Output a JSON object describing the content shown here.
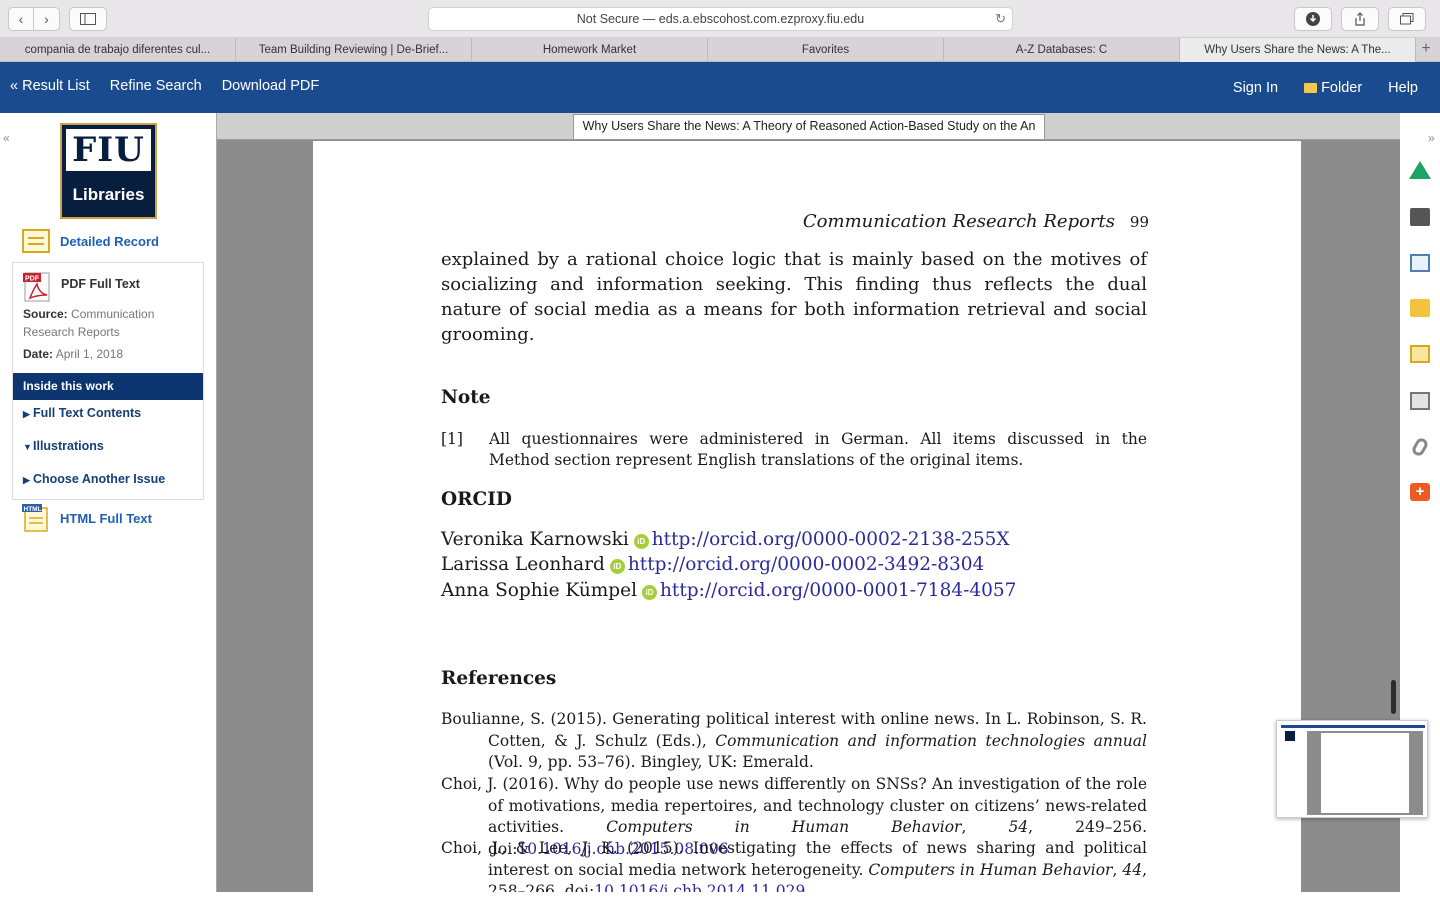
{
  "browser": {
    "url": "Not Secure — eds.a.ebscohost.com.ezproxy.fiu.edu",
    "tabs": [
      {
        "label": "compania de trabajo diferentes cul..."
      },
      {
        "label": "Team Building Reviewing | De-Brief..."
      },
      {
        "label": "Homework Market"
      },
      {
        "label": "Favorites"
      },
      {
        "label": "A-Z Databases: C"
      },
      {
        "label": "Why Users Share the News: A The..."
      }
    ],
    "new_tab": "+",
    "back": "‹",
    "forward": "›",
    "reload": "↻"
  },
  "topnav": {
    "result_list": "« Result List",
    "refine_search": "Refine Search",
    "download_pdf": "Download PDF",
    "sign_in": "Sign In",
    "folder": "Folder",
    "help": "Help"
  },
  "sidebar": {
    "collapse": "«",
    "logo_top": "FIU",
    "logo_bottom": "Libraries",
    "detailed_record": "Detailed Record",
    "pdf_full_text": "PDF Full Text",
    "pdf_badge": "PDF",
    "source_label": "Source:",
    "source_value": "Communication Research Reports",
    "date_label": "Date:",
    "date_value": "April 1, 2018",
    "inside_this_work": "Inside this work",
    "full_text_contents": "Full Text Contents",
    "illustrations": "Illustrations",
    "choose_another_issue": "Choose Another Issue",
    "html_full_text": "HTML Full Text",
    "html_badge": "HTML"
  },
  "viewer": {
    "doc_title": "Why Users Share the News: A Theory of Reasoned Action-Based Study on the An",
    "running_head": "Communication Research Reports",
    "page_number": "99",
    "intro_paragraph": "explained by a rational choice logic that is mainly based on the motives of socializing and information seeking. This finding thus reflects the dual nature of social media as a means for both information retrieval and social grooming.",
    "note_heading": "Note",
    "note_number": "[1]",
    "note_text": "All questionnaires were administered in German. All items discussed in the Method section represent English translations of the original items.",
    "orcid_heading": "ORCID",
    "orcid_badge": "iD",
    "orcids": [
      {
        "name": "Veronika Karnowski",
        "url": "http://orcid.org/0000-0002-2138-255X"
      },
      {
        "name": "Larissa Leonhard",
        "url": "http://orcid.org/0000-0002-3492-8304"
      },
      {
        "name": "Anna Sophie Kümpel",
        "url": "http://orcid.org/0000-0001-7184-4057"
      }
    ],
    "references_heading": "References",
    "ref1_a": "Boulianne, S. (2015). Generating political interest with online news. In L. Robinson, S. R. Cotten, & J. Schulz (Eds.), ",
    "ref1_i": "Communication and information technologies annual",
    "ref1_b": " (Vol. 9, pp. 53–76). Bingley, UK: Emerald.",
    "ref2_a": "Choi, J. (2016). Why do people use news differently on SNSs? An investigation of the role of motivations, media repertoires, and technology cluster on citizens’ news-related activities. ",
    "ref2_i": "Computers in Human Behavior",
    "ref2_b": ", ",
    "ref2_vol": "54",
    "ref2_c": ", 249–256. doi:",
    "ref2_doi": "10.1016/j.chb.2015.08.006",
    "ref3_a": "Choi, J., & Lee, J. K. (2015). Investigating the effects of news sharing and political interest on social media network heterogeneity. ",
    "ref3_i": "Computers in Human Behavior",
    "ref3_b": ", ",
    "ref3_vol": "44",
    "ref3_c": ", 258–266. doi:",
    "ref3_doi": "10.1016/j.chb.2014.11.029"
  },
  "tools": {
    "collapse": "»",
    "add": "+"
  },
  "colors": {
    "nav_blue": "#1b4b8f",
    "inside_blue": "#0d3570",
    "link_blue": "#1d5fb8",
    "orcid_green": "#a6ce39"
  }
}
